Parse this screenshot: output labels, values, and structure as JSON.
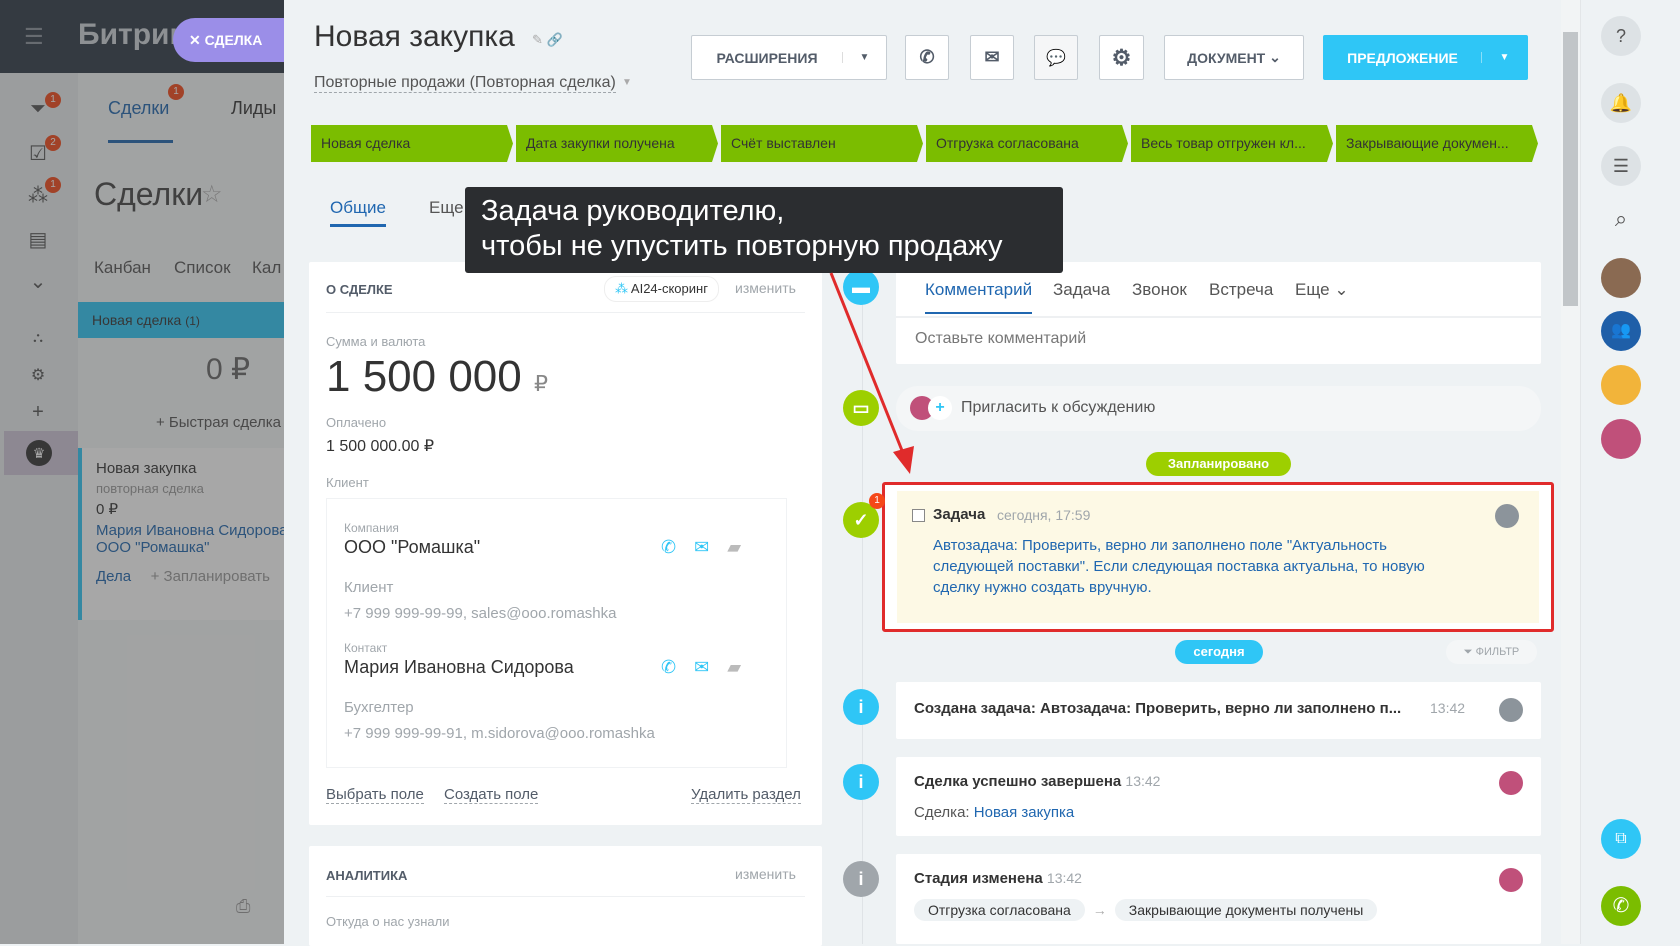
{
  "left": {
    "logo": "Битрикс",
    "close_tag": "СДЕЛКА",
    "tabs": [
      "Сделки",
      "Лиды"
    ],
    "tab_badge": "1",
    "nav_badges": [
      "1",
      "2",
      "1"
    ],
    "title": "Сделки",
    "views": [
      "Канбан",
      "Список",
      "Кал"
    ],
    "column": {
      "name": "Новая сделка",
      "count": "(1)",
      "sum": "0 ₽",
      "quick": "+ Быстрая сделка"
    },
    "deal": {
      "title": "Новая закупка",
      "subtitle": "повторная сделка",
      "sum": "0 ₽",
      "contact": "Мария Ивановна Сидорова",
      "company": "ООО \"Ромашка\"",
      "activities": "Дела",
      "plan": "+ Запланировать"
    }
  },
  "header": {
    "title": "Новая закупка",
    "category": "Повторные продажи (Повторная сделка)",
    "extensions": "РАСШИРЕНИЯ",
    "document": "ДОКУМЕНТ",
    "proposal": "ПРЕДЛОЖЕНИЕ"
  },
  "stages": [
    "Новая сделка",
    "Дата закупки получена",
    "Счёт выставлен",
    "Отгрузка согласована",
    "Весь товар отгружен кл...",
    "Закрывающие докумен..."
  ],
  "stage_color": "#7bbd00",
  "tabs": {
    "general": "Общие",
    "more": "Еще"
  },
  "tooltip": {
    "line1": "Задача руководителю,",
    "line2": "чтобы не упустить повторную продажу"
  },
  "about": {
    "title": "О СДЕЛКЕ",
    "scoring": "AI24-скоринг",
    "edit": "изменить",
    "sum_label": "Сумма и валюта",
    "sum": "1 500 000",
    "currency": "₽",
    "paid_label": "Оплачено",
    "paid": "1 500 000.00 ₽",
    "client_label": "Клиент",
    "company_label": "Компания",
    "company": "ООО \"Ромашка\"",
    "client_sub": "Клиент",
    "client_info": "+7 999 999-99-99, sales@ooo.romashka",
    "contact_label": "Контакт",
    "contact": "Мария Ивановна Сидорова",
    "contact_role": "Бухгелтер",
    "contact_info": "+7 999 999-99-91, m.sidorova@ooo.romashka",
    "select_field": "Выбрать поле",
    "create_field": "Создать поле",
    "delete_section": "Удалить раздел"
  },
  "analytics": {
    "title": "АНАЛИТИКА",
    "edit": "изменить",
    "source": "Откуда о нас узнали"
  },
  "timeline": {
    "tabs": [
      "Комментарий",
      "Задача",
      "Звонок",
      "Встреча",
      "Еще"
    ],
    "comment_placeholder": "Оставьте комментарий",
    "invite": "Пригласить к обсуждению",
    "planned": "Запланировано",
    "task": {
      "label": "Задача",
      "time": "сегодня, 17:59",
      "badge": "1",
      "text": "Автозадача: Проверить, верно ли заполнено поле \"Актуальность следующей поставки\". Если следующая поставка актуальна, то новую сделку нужно создать вручную."
    },
    "today": "сегодня",
    "filter": "ФИЛЬТР",
    "entries": [
      {
        "title": "Создана задача: Автозадача: Проверить, верно ли заполнено п...",
        "time": "13:42"
      },
      {
        "title": "Сделка успешно завершена",
        "time": "13:42",
        "sub_label": "Сделка:",
        "sub_link": "Новая закупка"
      },
      {
        "title": "Стадия изменена",
        "time": "13:42",
        "from": "Отгрузка согласована",
        "arrow": "→",
        "to": "Закрывающие документы получены"
      }
    ]
  },
  "accent": "#2fc6f6",
  "highlight": "#e02b2b"
}
